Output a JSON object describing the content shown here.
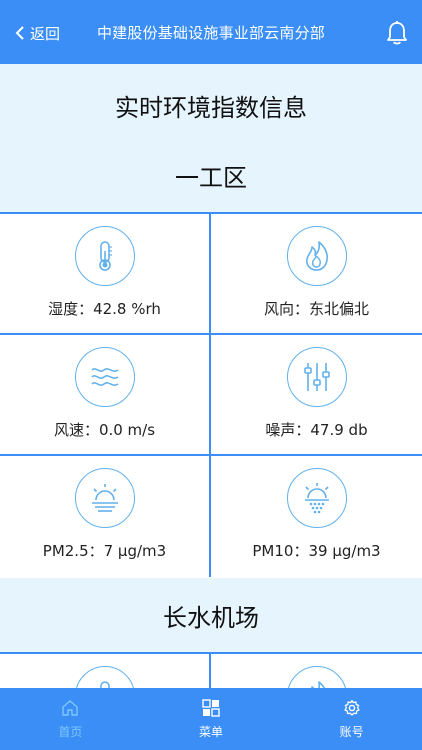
{
  "header": {
    "back_label": "返回",
    "title": "中建股份基础设施事业部云南分部"
  },
  "main": {
    "page_title": "实时环境指数信息",
    "zones": [
      {
        "name": "一工区",
        "metrics": [
          {
            "label": "湿度：42.8 %rh",
            "icon": "thermometer-icon"
          },
          {
            "label": "风向：东北偏北",
            "icon": "flame-icon"
          },
          {
            "label": "风速：0.0 m/s",
            "icon": "wind-waves-icon"
          },
          {
            "label": "噪声：47.9 db",
            "icon": "equalizer-icon"
          },
          {
            "label": "PM2.5：7 μg/m3",
            "icon": "sunrise-icon"
          },
          {
            "label": "PM10：39 μg/m3",
            "icon": "sun-dust-icon"
          }
        ]
      },
      {
        "name": "长水机场"
      }
    ]
  },
  "tabbar": {
    "items": [
      {
        "label": "首页",
        "icon": "home-icon",
        "active": true
      },
      {
        "label": "菜单",
        "icon": "grid-menu-icon",
        "active": false
      },
      {
        "label": "账号",
        "icon": "gear-icon",
        "active": false
      }
    ]
  },
  "colors": {
    "primary": "#3a8ef6",
    "band": "#e6f4fd",
    "icon_stroke": "#62b1ec",
    "active_tab": "#7fc8ff"
  }
}
